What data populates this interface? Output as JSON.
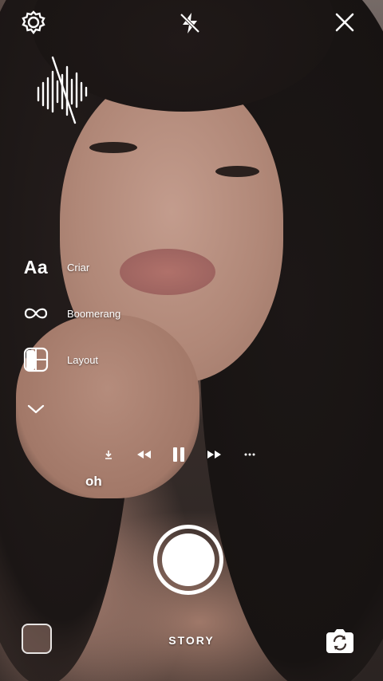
{
  "top_bar": {
    "settings_icon": "gear-icon",
    "flash_icon": "flash-off-icon",
    "close_icon": "close-icon"
  },
  "audio_icon": "soundwave-icon",
  "modes": [
    {
      "name": "create",
      "icon_text": "Aa",
      "label": "Criar"
    },
    {
      "name": "boomerang",
      "icon": "infinity-icon",
      "label": "Boomerang"
    },
    {
      "name": "layout",
      "icon": "layout-grid-icon",
      "label": "Layout"
    },
    {
      "name": "more",
      "icon": "chevron-down-icon",
      "label": ""
    }
  ],
  "music_player": {
    "controls": [
      "download-icon",
      "rewind-icon",
      "pause-icon",
      "fast-forward-icon",
      "more-icon"
    ],
    "lyric": "oh"
  },
  "bottom": {
    "mode_label": "STORY",
    "gallery_icon": "gallery-thumbnail",
    "flip_icon": "flip-camera-icon"
  }
}
